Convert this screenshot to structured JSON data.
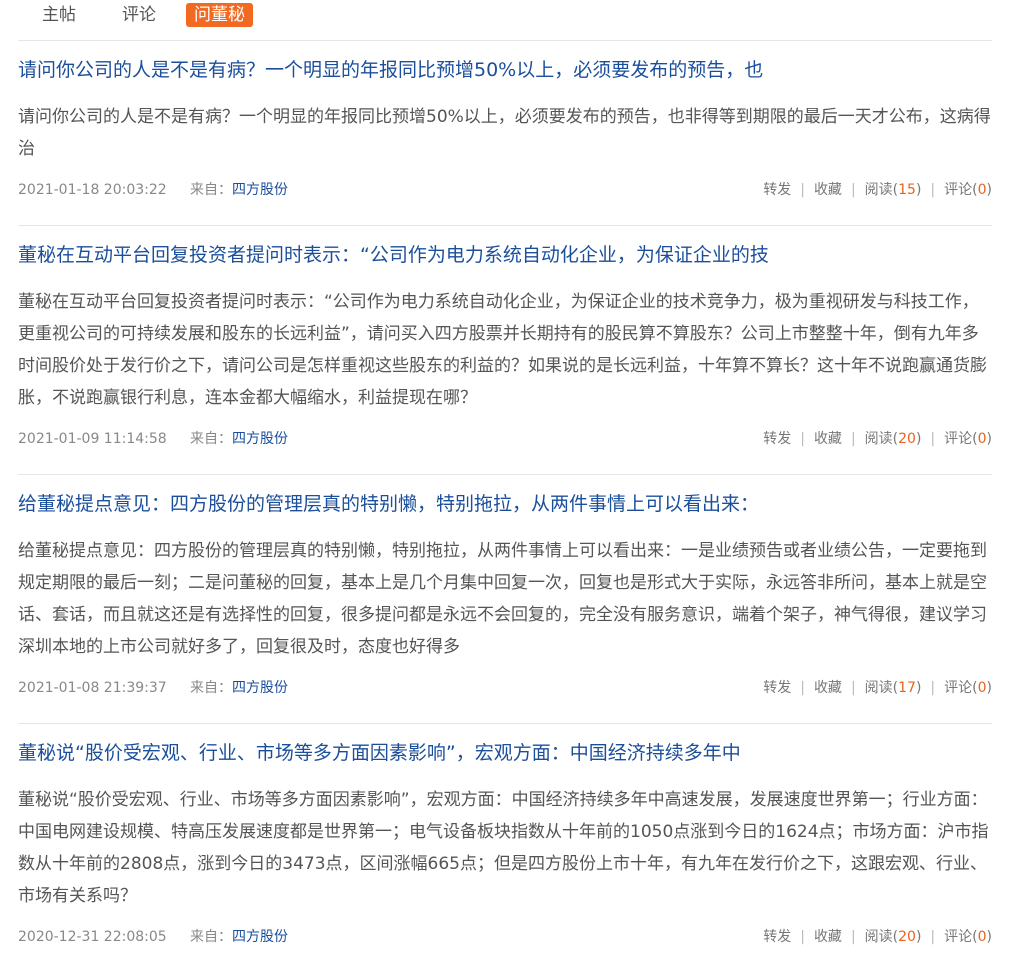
{
  "tabs": [
    {
      "label": "主帖"
    },
    {
      "label": "评论"
    },
    {
      "label": "问董秘"
    }
  ],
  "action_labels": {
    "forward": "转发",
    "collect": "收藏",
    "read": "阅读",
    "comment": "评论",
    "from": "来自："
  },
  "posts": [
    {
      "title": "请问你公司的人是不是有病？一个明显的年报同比预增50%以上，必须要发布的预告，也",
      "body": "请问你公司的人是不是有病？一个明显的年报同比预增50%以上，必须要发布的预告，也非得等到期限的最后一天才公布，这病得治",
      "date": "2021-01-18 20:03:22",
      "source": "四方股份",
      "reads": "15",
      "comments": "0"
    },
    {
      "title": "董秘在互动平台回复投资者提问时表示：“公司作为电力系统自动化企业，为保证企业的技",
      "body": "董秘在互动平台回复投资者提问时表示：“公司作为电力系统自动化企业，为保证企业的技术竞争力，极为重视研发与科技工作，更重视公司的可持续发展和股东的长远利益”，请问买入四方股票并长期持有的股民算不算股东？公司上市整整十年，倒有九年多时间股价处于发行价之下，请问公司是怎样重视这些股东的利益的？如果说的是长远利益，十年算不算长？这十年不说跑赢通货膨胀，不说跑赢银行利息，连本金都大幅缩水，利益提现在哪？",
      "date": "2021-01-09 11:14:58",
      "source": "四方股份",
      "reads": "20",
      "comments": "0"
    },
    {
      "title": "给董秘提点意见：四方股份的管理层真的特别懒，特别拖拉，从两件事情上可以看出来：",
      "body": "给董秘提点意见：四方股份的管理层真的特别懒，特别拖拉，从两件事情上可以看出来：一是业绩预告或者业绩公告，一定要拖到规定期限的最后一刻；二是问董秘的回复，基本上是几个月集中回复一次，回复也是形式大于实际，永远答非所问，基本上就是空话、套话，而且就这还是有选择性的回复，很多提问都是永远不会回复的，完全没有服务意识，端着个架子，神气得很，建议学习深圳本地的上市公司就好多了，回复很及时，态度也好得多",
      "date": "2021-01-08 21:39:37",
      "source": "四方股份",
      "reads": "17",
      "comments": "0"
    },
    {
      "title": "董秘说“股价受宏观、行业、市场等多方面因素影响”，宏观方面：中国经济持续多年中",
      "body": "董秘说“股价受宏观、行业、市场等多方面因素影响”，宏观方面：中国经济持续多年中高速发展，发展速度世界第一；行业方面：中国电网建设规模、特高压发展速度都是世界第一；电气设备板块指数从十年前的1050点涨到今日的1624点；市场方面：沪市指数从十年前的2808点，涨到今日的3473点，区间涨幅665点；但是四方股份上市十年，有九年在发行价之下，这跟宏观、行业、市场有关系吗？",
      "date": "2020-12-31 22:08:05",
      "source": "四方股份",
      "reads": "20",
      "comments": "0"
    }
  ]
}
